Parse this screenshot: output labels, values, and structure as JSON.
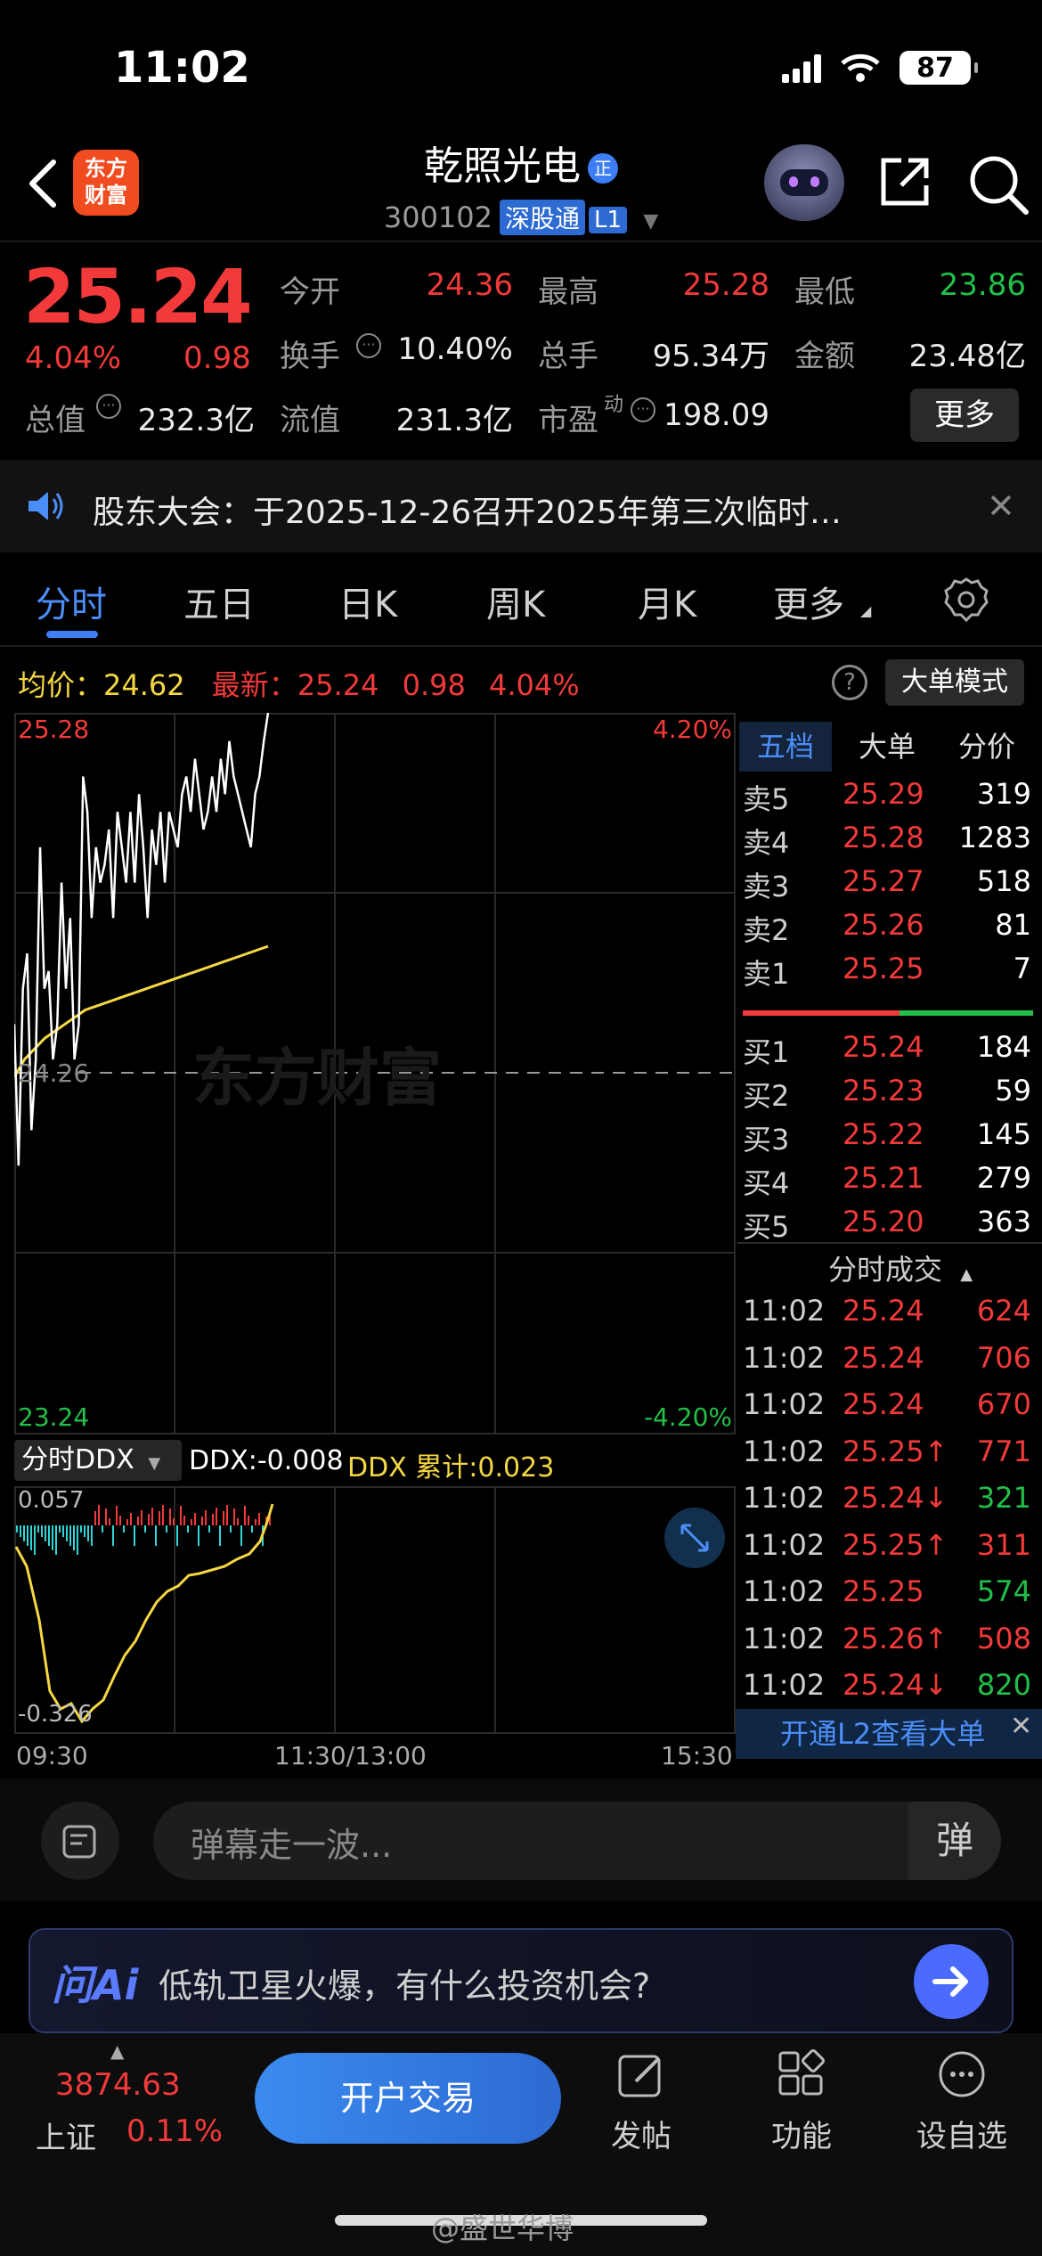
{
  "status_bar": {
    "time": "11:02",
    "battery": "87"
  },
  "header": {
    "logo_text": "东方财富",
    "stock_name": "乾照光电",
    "name_tag": "正",
    "code": "300102",
    "connect_badge": "深股通",
    "level_badge": "L1"
  },
  "quote": {
    "price": "25.24",
    "change_pct": "4.04%",
    "change": "0.98",
    "open_label": "今开",
    "open": "24.36",
    "high_label": "最高",
    "high": "25.28",
    "low_label": "最低",
    "low": "23.86",
    "turnover_label": "换手",
    "turnover": "10.40%",
    "volume_label": "总手",
    "volume": "95.34万",
    "amount_label": "金额",
    "amount": "23.48亿",
    "mktcap_label": "总值",
    "mktcap": "232.3亿",
    "float_label": "流值",
    "float_cap": "231.3亿",
    "pe_label": "市盈",
    "pe_sup": "动",
    "pe": "198.09",
    "more_label": "更多"
  },
  "notice": {
    "text": "股东大会：于2025-12-26召开2025年第三次临时…"
  },
  "tabs": [
    "分时",
    "五日",
    "日K",
    "周K",
    "月K",
    "更多"
  ],
  "info_row": {
    "avg_label": "均价：",
    "avg": "24.62",
    "last_label": "最新：",
    "last": "25.24",
    "last_chg": "0.98",
    "last_pct": "4.04%",
    "big_order_label": "大单模式"
  },
  "chart_axis": {
    "top_price": "25.28",
    "bottom_price": "23.24",
    "mid_price": "24.26",
    "top_pct": "4.20%",
    "bottom_pct": "-4.20%",
    "ddx_top": "0.057",
    "ddx_bottom": "-0.326",
    "time_start": "09:30",
    "time_mid": "11:30/13:00",
    "time_end": "15:30",
    "watermark": "东方财富"
  },
  "ddx": {
    "selector": "分时DDX",
    "ddx_label": "DDX:-0.008",
    "ddx_sum_label": "DDX 累计:0.023"
  },
  "chart_data": {
    "type": "line",
    "ylim": [
      23.24,
      25.28
    ],
    "series": [
      {
        "values": [
          24.4,
          24.0,
          24.5,
          24.6,
          24.1,
          24.3,
          24.9,
          24.5,
          24.55,
          24.3,
          24.4,
          24.8,
          24.5,
          24.7,
          24.3,
          24.4,
          25.1,
          25.0,
          24.7,
          24.9,
          24.8,
          24.85,
          24.95,
          24.7,
          25.0,
          24.9,
          24.8,
          25.0,
          24.8,
          25.05,
          24.9,
          24.7,
          24.95,
          24.85,
          25.0,
          24.8,
          25.0,
          24.95,
          24.9,
          25.05,
          25.1,
          25.0,
          25.15,
          25.05,
          24.95,
          25.0,
          25.1,
          25.0,
          25.15,
          25.05,
          25.2,
          25.1,
          25.05,
          25.0,
          24.95,
          24.9,
          25.05,
          25.1,
          25.2,
          25.28
        ]
      },
      {
        "values": [
          24.25,
          24.3,
          24.33,
          24.36,
          24.38,
          24.4,
          24.42,
          24.44,
          24.45,
          24.46,
          24.47,
          24.48,
          24.49,
          24.5,
          24.51,
          24.52,
          24.53,
          24.54,
          24.55,
          24.56,
          24.57,
          24.58,
          24.59,
          24.6,
          24.61,
          24.62
        ]
      }
    ]
  },
  "order_book": {
    "tabs": [
      "五档",
      "大单",
      "分价"
    ],
    "asks": [
      {
        "label": "卖5",
        "price": "25.29",
        "vol": "319"
      },
      {
        "label": "卖4",
        "price": "25.28",
        "vol": "1283"
      },
      {
        "label": "卖3",
        "price": "25.27",
        "vol": "518"
      },
      {
        "label": "卖2",
        "price": "25.26",
        "vol": "81"
      },
      {
        "label": "卖1",
        "price": "25.25",
        "vol": "7"
      }
    ],
    "bids": [
      {
        "label": "买1",
        "price": "25.24",
        "vol": "184"
      },
      {
        "label": "买2",
        "price": "25.23",
        "vol": "59"
      },
      {
        "label": "买3",
        "price": "25.22",
        "vol": "145"
      },
      {
        "label": "买4",
        "price": "25.21",
        "vol": "279"
      },
      {
        "label": "买5",
        "price": "25.20",
        "vol": "363"
      }
    ],
    "trades_title": "分时成交",
    "trades": [
      {
        "time": "11:02",
        "price": "25.24",
        "vol": "624",
        "dir": "up"
      },
      {
        "time": "11:02",
        "price": "25.24",
        "vol": "706",
        "dir": "up"
      },
      {
        "time": "11:02",
        "price": "25.24",
        "vol": "670",
        "dir": "up"
      },
      {
        "time": "11:02",
        "price": "25.25↑",
        "vol": "771",
        "dir": "up"
      },
      {
        "time": "11:02",
        "price": "25.24↓",
        "vol": "321",
        "dir": "down"
      },
      {
        "time": "11:02",
        "price": "25.25↑",
        "vol": "311",
        "dir": "up"
      },
      {
        "time": "11:02",
        "price": "25.25",
        "vol": "574",
        "dir": "down"
      },
      {
        "time": "11:02",
        "price": "25.26↑",
        "vol": "508",
        "dir": "up"
      },
      {
        "time": "11:02",
        "price": "25.24↓",
        "vol": "820",
        "dir": "down"
      }
    ],
    "l2_banner": "开通L2查看大单"
  },
  "comment": {
    "placeholder": "弹幕走一波...",
    "danmu": "弹"
  },
  "ai_bar": {
    "logo": "问Ai",
    "prompt": "低轨卫星火爆，有什么投资机会?"
  },
  "bottom_nav": {
    "index_value": "3874.63",
    "index_name": "上证",
    "index_pct": "0.11%",
    "trade_button": "开户交易",
    "items": [
      "发帖",
      "功能",
      "设自选"
    ]
  },
  "watermark_text": "@盛世华博",
  "colors": {
    "up": "#f23a3a",
    "down": "#22c04a",
    "accent": "#3d7ef5",
    "avg": "#f5d742"
  }
}
